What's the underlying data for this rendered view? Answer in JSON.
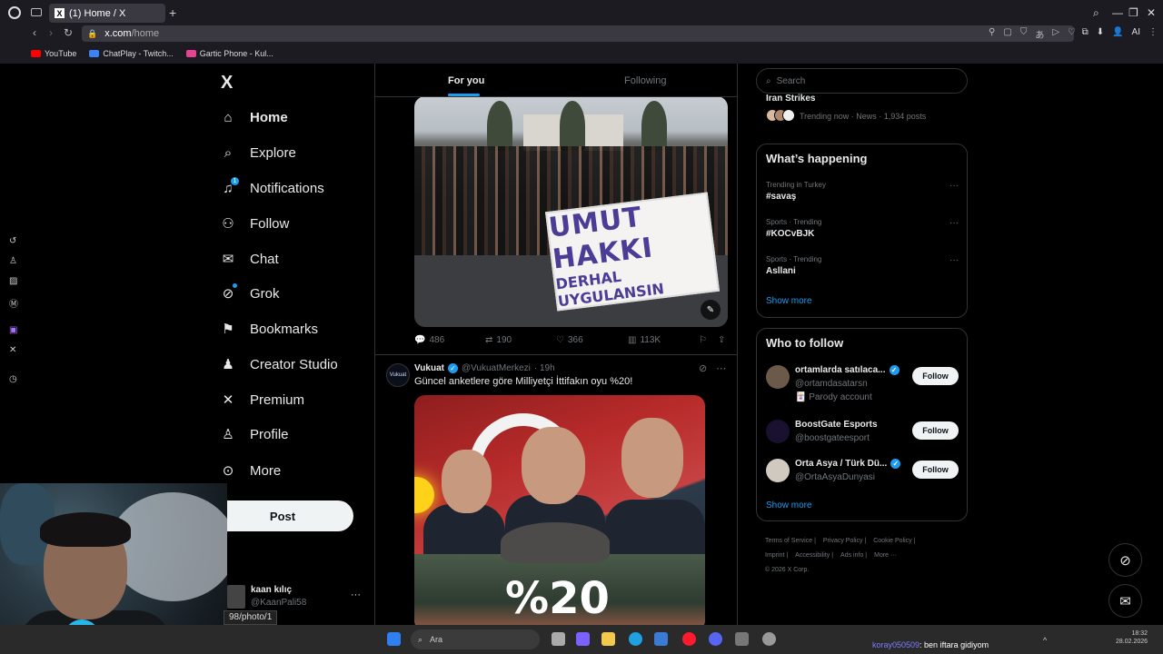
{
  "browser": {
    "tab_title": "(1) Home / X",
    "url_host": "x.com",
    "url_path": "/home",
    "ai_label": "AI",
    "bookmarks": [
      {
        "label": "YouTube",
        "color": "#ff0000"
      },
      {
        "label": "ChatPlay - Twitch...",
        "color": "#3b82f6"
      },
      {
        "label": "Gartic Phone - Kul...",
        "color": "#e84393"
      }
    ]
  },
  "nav": {
    "logo": "X",
    "items": [
      {
        "label": "Home",
        "icon": "home-icon",
        "glyph": "⌂"
      },
      {
        "label": "Explore",
        "icon": "search-icon",
        "glyph": "⌕"
      },
      {
        "label": "Notifications",
        "icon": "bell-icon",
        "glyph": "🔔",
        "badge": "1"
      },
      {
        "label": "Follow",
        "icon": "add-person-icon",
        "glyph": "👤"
      },
      {
        "label": "Chat",
        "icon": "mail-icon",
        "glyph": "✉"
      },
      {
        "label": "Grok",
        "icon": "grok-icon",
        "glyph": "⊘"
      },
      {
        "label": "Bookmarks",
        "icon": "bookmark-icon",
        "glyph": "🔖"
      },
      {
        "label": "Creator Studio",
        "icon": "creator-studio-icon",
        "glyph": "♟"
      },
      {
        "label": "Premium",
        "icon": "x-premium-icon",
        "glyph": "𝕏"
      },
      {
        "label": "Profile",
        "icon": "person-icon",
        "glyph": "👤"
      },
      {
        "label": "More",
        "icon": "more-circle-icon",
        "glyph": "⋯"
      }
    ],
    "post_label": "Post",
    "account": {
      "name": "kaan kılıç",
      "handle": "@KaanPali58",
      "more": "···"
    }
  },
  "link_tooltip": "98/photo/1",
  "feed": {
    "tabs": [
      "For you",
      "Following"
    ],
    "post1": {
      "banner_line1": "UMUT HAKKI",
      "banner_line2": "DERHAL UYGULANSIN",
      "replies": "486",
      "reposts": "190",
      "likes": "366",
      "views": "113K"
    },
    "post2": {
      "avatar_text": "Vukuat",
      "name": "Vukuat",
      "handle": "@VukuatMerkezi",
      "time": "· 19h",
      "text": "Güncel anketlere göre Milliyetçi İttifakın oyu %20!",
      "image_text": "%20"
    }
  },
  "sidebar": {
    "search_placeholder": "Search",
    "top_trend": {
      "title": "Iran Strikes",
      "meta": "Trending now · News · 1,934 posts"
    },
    "happening": {
      "title": "What’s happening",
      "trends": [
        {
          "meta": "Trending in Turkey",
          "name": "#savaş"
        },
        {
          "meta": "Sports · Trending",
          "name": "#KOCvBJK"
        },
        {
          "meta": "Sports · Trending",
          "name": "Asllani"
        }
      ],
      "show_more": "Show more"
    },
    "who_to_follow": {
      "title": "Who to follow",
      "accounts": [
        {
          "name": "ortamlarda satılaca...",
          "handle": "@ortamdasatarsn",
          "sub": "🃏 Parody account",
          "verified": true,
          "avatar_color": "#6b5a4a"
        },
        {
          "name": "BoostGate Esports",
          "handle": "@boostgateesport",
          "sub": "",
          "verified": false,
          "avatar_color": "#1a1030"
        },
        {
          "name": "Orta Asya / Türk Dü...",
          "handle": "@OrtaAsyaDunyasi",
          "sub": "",
          "verified": true,
          "avatar_color": "#cfc9c0"
        }
      ],
      "follow_label": "Follow",
      "show_more": "Show more"
    },
    "footer": [
      "Terms of Service |",
      "Privacy Policy |",
      "Cookie Policy |",
      "Imprint |",
      "Accessibility |",
      "Ads info |",
      "More ···",
      "© 2026 X Corp."
    ]
  },
  "taskbar": {
    "search_text": "Ara",
    "chat_user": "koray050509",
    "chat_text": ": ben iftara gidiyom",
    "clock_time": "18:32",
    "clock_date": "28.02.2026"
  },
  "colors": {
    "accent": "#1d9bf0",
    "bg": "#000000",
    "border": "#2f3336",
    "muted": "#71767b"
  }
}
